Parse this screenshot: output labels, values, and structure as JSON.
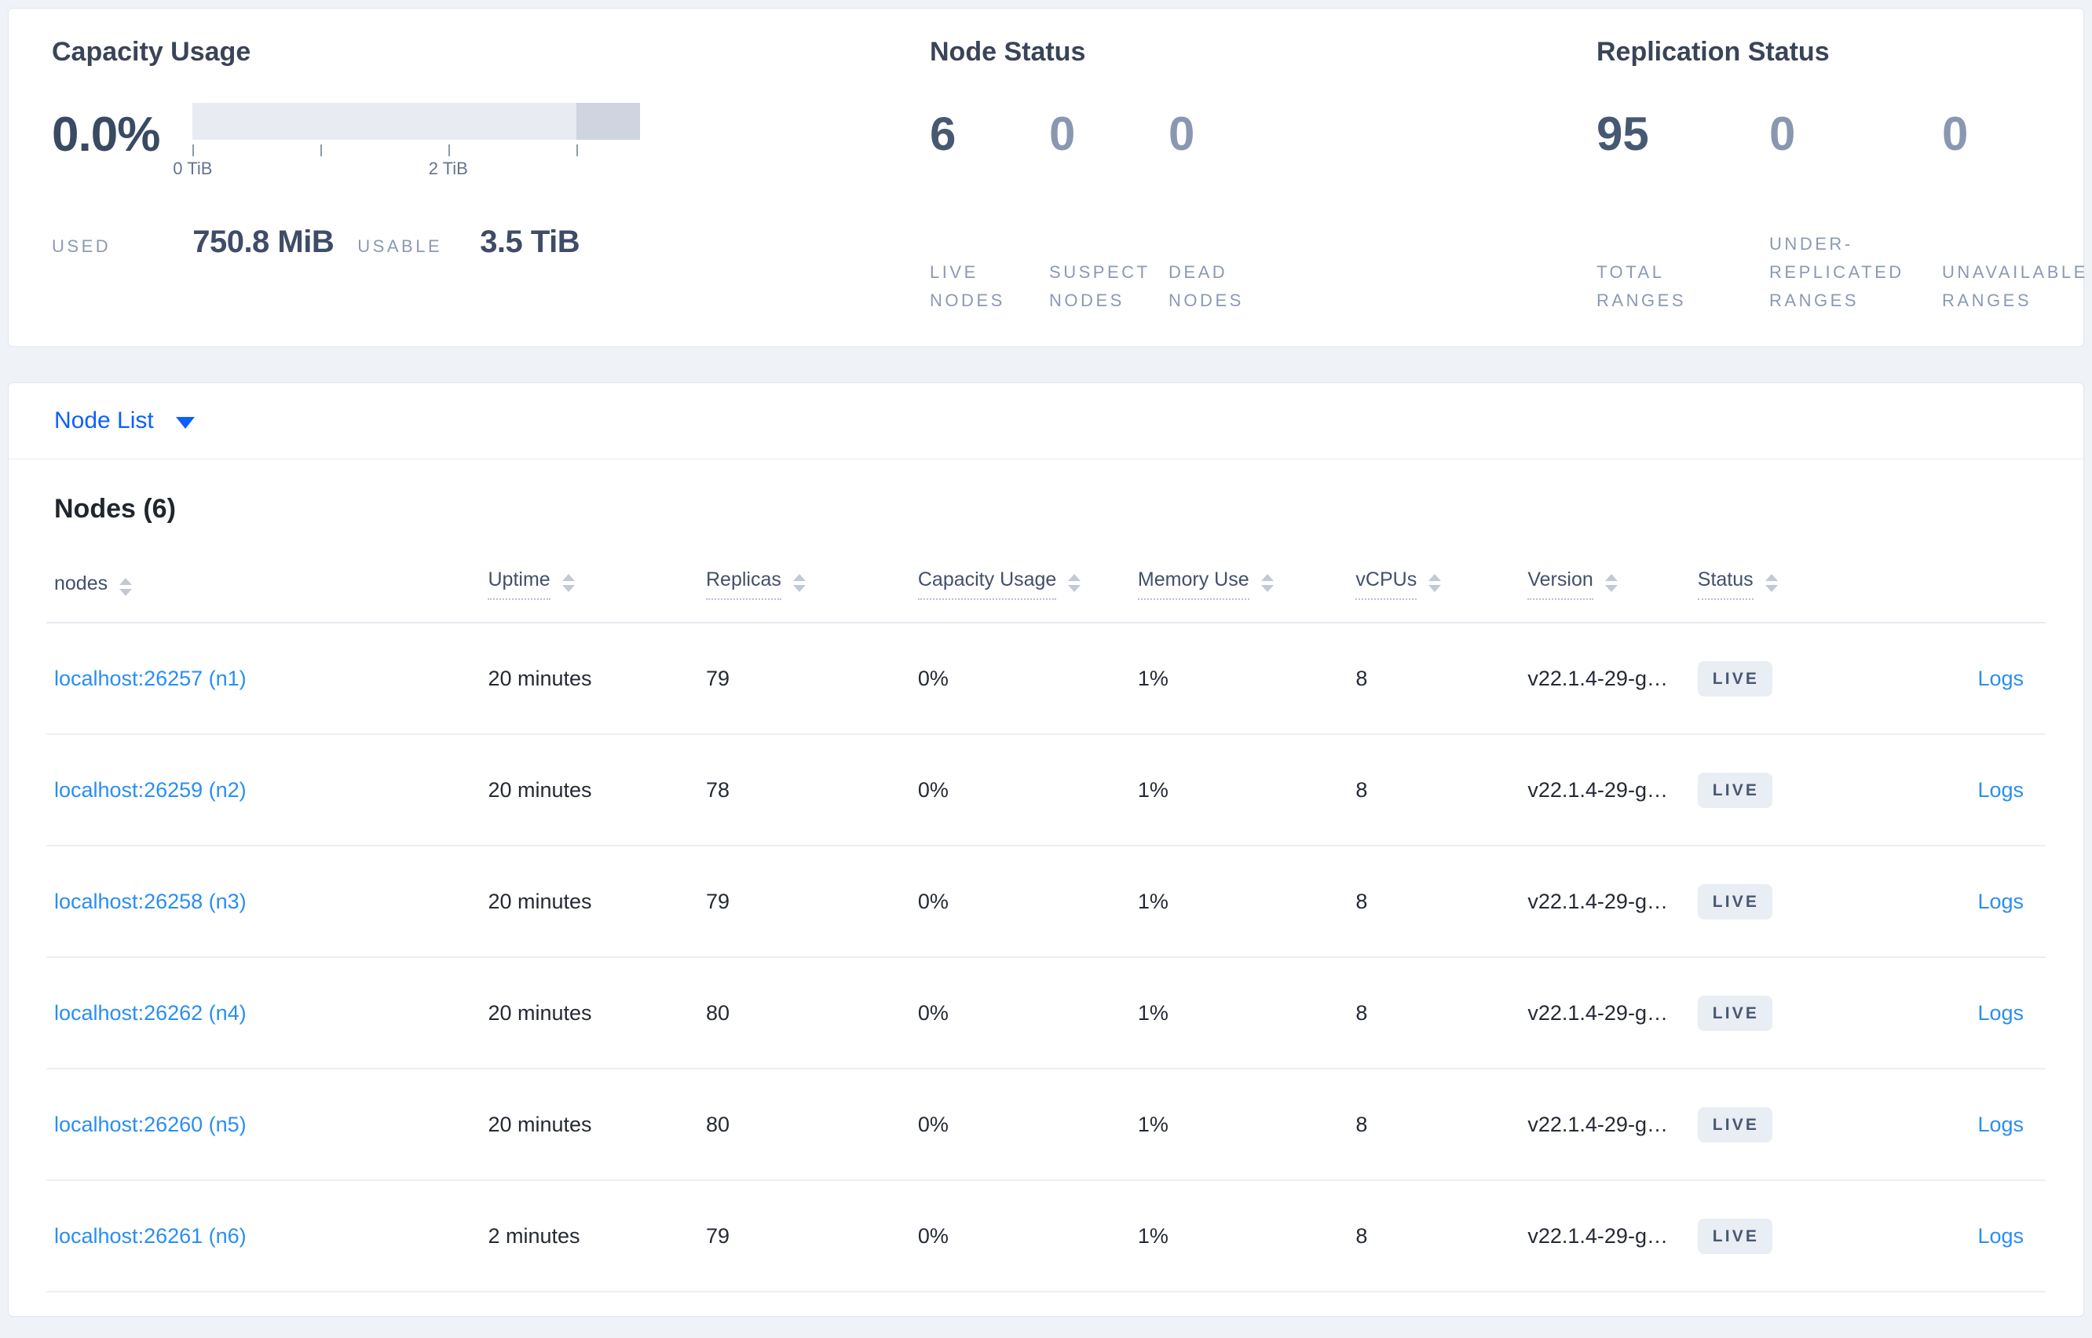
{
  "colors": {
    "accent_blue": "#0b5fff",
    "link_blue": "#2a8ef2",
    "live_badge_bg": "#e9edf4",
    "live_badge_text": "#475872",
    "capacity_bar_track": "#e8ebf2",
    "capacity_bar_cap": "#cfd4e0",
    "page_background": "#eff2f7"
  },
  "summary": {
    "capacity": {
      "title": "Capacity Usage",
      "percent": "0.0%",
      "bar": {
        "cap_start_percent": 85.7
      },
      "ticks": [
        {
          "pos": 0,
          "label": "0 TiB"
        },
        {
          "pos": 28.6,
          "label": ""
        },
        {
          "pos": 57.1,
          "label": "2 TiB"
        },
        {
          "pos": 85.7,
          "label": ""
        }
      ],
      "used_label": "USED",
      "used_value": "750.8 MiB",
      "usable_label": "USABLE",
      "usable_value": "3.5 TiB"
    },
    "node_status": {
      "title": "Node Status",
      "stats": [
        {
          "value": "6",
          "label": "LIVE NODES",
          "em": true
        },
        {
          "value": "0",
          "label": "SUSPECT NODES"
        },
        {
          "value": "0",
          "label": "DEAD NODES"
        }
      ]
    },
    "replication": {
      "title": "Replication Status",
      "stats": [
        {
          "value": "95",
          "label": "TOTAL RANGES",
          "em": true
        },
        {
          "value": "0",
          "label": "UNDER-REPLICATED RANGES"
        },
        {
          "value": "0",
          "label": "UNAVAILABLE RANGES"
        }
      ]
    }
  },
  "node_list": {
    "label": "Node List"
  },
  "nodes_section": {
    "heading": "Nodes (6)",
    "columns": [
      {
        "label": "nodes",
        "sortable": true
      },
      {
        "label": "Uptime",
        "sortable": true,
        "dotted": true
      },
      {
        "label": "Replicas",
        "sortable": true,
        "dotted": true
      },
      {
        "label": "Capacity Usage",
        "sortable": true,
        "dotted": true
      },
      {
        "label": "Memory Use",
        "sortable": true,
        "dotted": true
      },
      {
        "label": "vCPUs",
        "sortable": true,
        "dotted": true
      },
      {
        "label": "Version",
        "sortable": true,
        "dotted": true
      },
      {
        "label": "Status",
        "sortable": true,
        "dotted": true
      },
      {
        "label": ""
      }
    ],
    "rows": [
      {
        "node": "localhost:26257 (n1)",
        "uptime": "20 minutes",
        "replicas": "79",
        "capacity": "0%",
        "memory": "1%",
        "vcpus": "8",
        "version": "v22.1.4-29-g…",
        "status": "LIVE",
        "logs": "Logs"
      },
      {
        "node": "localhost:26259 (n2)",
        "uptime": "20 minutes",
        "replicas": "78",
        "capacity": "0%",
        "memory": "1%",
        "vcpus": "8",
        "version": "v22.1.4-29-g…",
        "status": "LIVE",
        "logs": "Logs"
      },
      {
        "node": "localhost:26258 (n3)",
        "uptime": "20 minutes",
        "replicas": "79",
        "capacity": "0%",
        "memory": "1%",
        "vcpus": "8",
        "version": "v22.1.4-29-g…",
        "status": "LIVE",
        "logs": "Logs"
      },
      {
        "node": "localhost:26262 (n4)",
        "uptime": "20 minutes",
        "replicas": "80",
        "capacity": "0%",
        "memory": "1%",
        "vcpus": "8",
        "version": "v22.1.4-29-g…",
        "status": "LIVE",
        "logs": "Logs"
      },
      {
        "node": "localhost:26260 (n5)",
        "uptime": "20 minutes",
        "replicas": "80",
        "capacity": "0%",
        "memory": "1%",
        "vcpus": "8",
        "version": "v22.1.4-29-g…",
        "status": "LIVE",
        "logs": "Logs"
      },
      {
        "node": "localhost:26261 (n6)",
        "uptime": "2 minutes",
        "replicas": "79",
        "capacity": "0%",
        "memory": "1%",
        "vcpus": "8",
        "version": "v22.1.4-29-g…",
        "status": "LIVE",
        "logs": "Logs"
      }
    ]
  }
}
